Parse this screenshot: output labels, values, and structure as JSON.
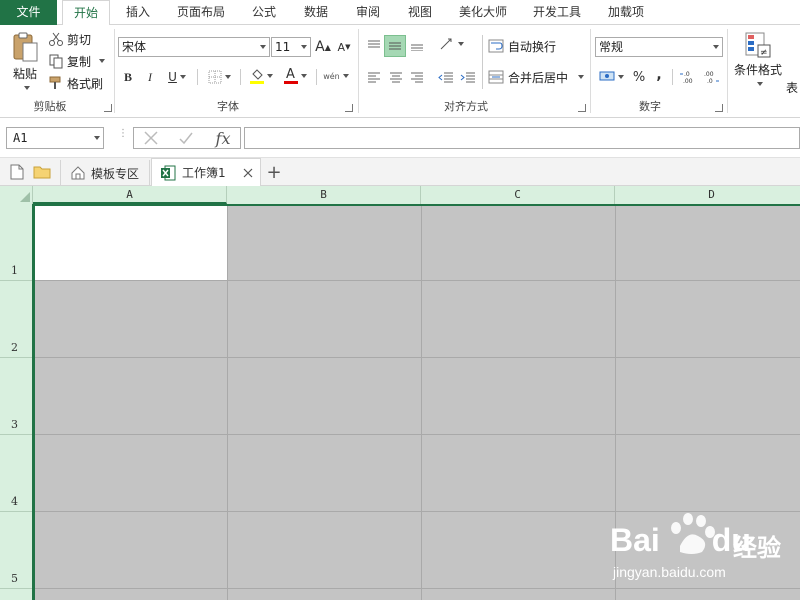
{
  "menu": {
    "file": "文件",
    "tabs": [
      "开始",
      "插入",
      "页面布局",
      "公式",
      "数据",
      "审阅",
      "视图",
      "美化大师",
      "开发工具",
      "加载项"
    ],
    "active": "开始"
  },
  "ribbon": {
    "clipboard": {
      "paste": "粘贴",
      "cut": "剪切",
      "copy": "复制",
      "format_painter": "格式刷",
      "label": "剪贴板"
    },
    "font": {
      "family": "宋体",
      "size": "11",
      "label": "字体",
      "bold": "B",
      "italic": "I",
      "underline": "U",
      "grow": "A",
      "shrink": "A",
      "font_color_letter": "A",
      "phonetic": "wén"
    },
    "alignment": {
      "wrap": "自动换行",
      "merge": "合并后居中",
      "label": "对齐方式"
    },
    "number": {
      "format": "常规",
      "percent": "%",
      "comma": ",",
      "inc_decimal": "←.0\n.00",
      "label": "数字"
    },
    "styles": {
      "conditional": "条件格式",
      "table_partial": "表"
    }
  },
  "formula_bar": {
    "name_box": "A1",
    "fx": "fx",
    "value": ""
  },
  "tabbar": {
    "templates": "模板专区",
    "workbook": "工作簿1",
    "add": "+"
  },
  "grid": {
    "columns": [
      "A",
      "B",
      "C",
      "D"
    ],
    "rows": [
      "1",
      "2",
      "3",
      "4",
      "5"
    ]
  },
  "watermark": {
    "brand": "Bai",
    "brand_suffix": "du",
    "product": "经验",
    "url": "jingyan.baidu.com"
  },
  "colors": {
    "accent": "#217346",
    "header_bg": "#d9f0df",
    "selection_fill": "#c4c4c4"
  }
}
